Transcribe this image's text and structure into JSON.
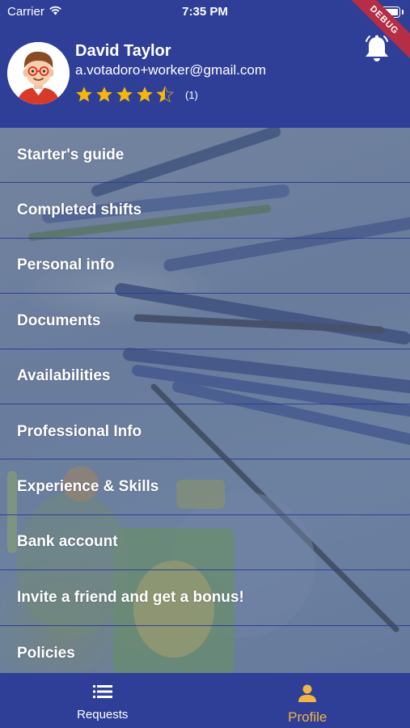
{
  "status_bar": {
    "carrier": "Carrier",
    "time": "7:35 PM"
  },
  "debug_banner": "DEBUG",
  "profile": {
    "name": "David Taylor",
    "email": "a.votadoro+worker@gmail.com",
    "rating": 4.5,
    "max_rating": 5,
    "rating_count": "(1)"
  },
  "menu": {
    "items": [
      {
        "label": "Starter's guide"
      },
      {
        "label": "Completed shifts"
      },
      {
        "label": "Personal info"
      },
      {
        "label": "Documents"
      },
      {
        "label": "Availabilities"
      },
      {
        "label": "Professional Info"
      },
      {
        "label": "Experience & Skills"
      },
      {
        "label": "Bank account"
      },
      {
        "label": "Invite a friend and get a bonus!"
      },
      {
        "label": "Policies"
      }
    ]
  },
  "tabs": {
    "requests": {
      "label": "Requests",
      "icon": "list-icon",
      "active": false
    },
    "profile": {
      "label": "Profile",
      "icon": "person-icon",
      "active": true
    }
  },
  "colors": {
    "primary": "#2f3f97",
    "accent": "#f2b545",
    "star": "#f5b70a",
    "debug": "#b52e45"
  }
}
